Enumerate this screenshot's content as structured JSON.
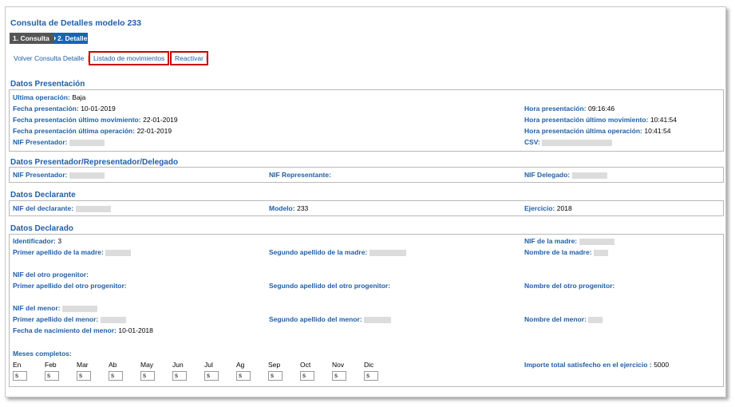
{
  "page_title": "Consulta de Detalles modelo 233",
  "steps": [
    "1. Consulta",
    "2. Detalle"
  ],
  "links": {
    "volver": "Volver Consulta Detalle",
    "listado": "Listado de movimientos",
    "reactivar": "Reactivar",
    "separator": "|"
  },
  "presentacion": {
    "heading": "Datos Presentación",
    "ultima_operacion_label": "Ultima operación:",
    "ultima_operacion_value": "Baja",
    "fecha_presentacion_label": "Fecha presentación:",
    "fecha_presentacion_value": "10-01-2019",
    "fecha_ultimo_mov_label": "Fecha presentación último movimiento:",
    "fecha_ultimo_mov_value": "22-01-2019",
    "fecha_ultima_op_label": "Fecha presentación última operación:",
    "fecha_ultima_op_value": "22-01-2019",
    "nif_presentador_label": "NIF Presentador:",
    "hora_presentacion_label": "Hora presentación:",
    "hora_presentacion_value": "09:16:46",
    "hora_ultimo_mov_label": "Hora presentación último movimiento:",
    "hora_ultimo_mov_value": "10:41:54",
    "hora_ultima_op_label": "Hora presentación última operación:",
    "hora_ultima_op_value": "10:41:54",
    "csv_label": "CSV:"
  },
  "presentador": {
    "heading": "Datos Presentador/Representador/Delegado",
    "nif_presentador_label": "NIF Presentador:",
    "nif_representante_label": "NIF Representante:",
    "nif_delegado_label": "NIF Delegado:"
  },
  "declarante": {
    "heading": "Datos Declarante",
    "nif_label": "NIF del declarante:",
    "modelo_label": "Modelo:",
    "modelo_value": "233",
    "ejercicio_label": "Ejercicio:",
    "ejercicio_value": "2018"
  },
  "declarado": {
    "heading": "Datos Declarado",
    "identificador_label": "Identificador:",
    "identificador_value": "3",
    "nif_madre_label": "NIF de la madre:",
    "primer_apellido_madre_label": "Primer apellido de la madre:",
    "segundo_apellido_madre_label": "Segundo apellido de la madre:",
    "nombre_madre_label": "Nombre de la madre:",
    "nif_otro_label": "NIF del otro progenitor:",
    "primer_apellido_otro_label": "Primer apellido del otro progenitor:",
    "segundo_apellido_otro_label": "Segundo apellido del otro progenitor:",
    "nombre_otro_label": "Nombre del otro progenitor:",
    "nif_menor_label": "NIF del menor:",
    "primer_apellido_menor_label": "Primer apellido del menor:",
    "segundo_apellido_menor_label": "Segundo apellido del menor:",
    "nombre_menor_label": "Nombre del menor:",
    "fecha_nac_menor_label": "Fecha de nacimiento del menor:",
    "fecha_nac_menor_value": "10-01-2018",
    "meses_label": "Meses completos:",
    "months": [
      "En",
      "Feb",
      "Mar",
      "Ab",
      "May",
      "Jun",
      "Jul",
      "Ag",
      "Sep",
      "Oct",
      "Nov",
      "Dic"
    ],
    "month_values": [
      "s",
      "s",
      "s",
      "s",
      "s",
      "s",
      "s",
      "s",
      "s",
      "s",
      "s",
      "s"
    ],
    "importe_label": "Importe total satisfecho en el ejercicio :",
    "importe_value": "5000"
  },
  "colors": {
    "accent": "#1f5fa8",
    "step_active": "#1564b6",
    "step_inactive": "#555555",
    "highlight_border": "#cc0000"
  }
}
